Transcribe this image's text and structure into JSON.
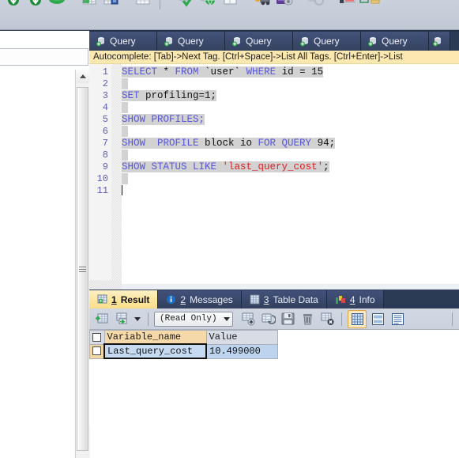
{
  "app": {
    "name": "sql-editor-window"
  },
  "toolbar": {
    "buttons": [
      {
        "name": "navicat-back-icon",
        "label": ""
      },
      {
        "name": "navicat-forward-icon",
        "label": ""
      },
      {
        "name": "navicat-green-icon",
        "label": ""
      },
      {
        "name": "new-table-icon",
        "label": ""
      },
      {
        "name": "table-design-icon",
        "label": ""
      },
      {
        "name": "table-grid-icon",
        "label": ""
      },
      {
        "name": "check-icon",
        "label": ""
      },
      {
        "name": "globe-icon",
        "label": ""
      },
      {
        "name": "panel-icon",
        "label": ""
      },
      {
        "name": "transfer-icon",
        "label": ""
      },
      {
        "name": "backup-icon",
        "label": ""
      },
      {
        "name": "circle-icon",
        "label": ""
      },
      {
        "name": "report-icon",
        "label": ""
      },
      {
        "name": "schedule-icon",
        "label": ""
      }
    ]
  },
  "left_pane": {
    "search_value": "",
    "search_placeholder": "",
    "scrollbar": {
      "position": "top"
    }
  },
  "query_tabs": [
    {
      "label": "Query",
      "icon": "query-icon",
      "active": false
    },
    {
      "label": "Query",
      "icon": "query-icon",
      "active": false
    },
    {
      "label": "Query",
      "icon": "query-icon",
      "active": false
    },
    {
      "label": "Query",
      "icon": "query-icon",
      "active": false
    },
    {
      "label": "Query",
      "icon": "query-icon",
      "active": false
    },
    {
      "label": "",
      "icon": "query-icon",
      "active": false
    }
  ],
  "autocomplete_hint": "Autocomplete: [Tab]->Next Tag. [Ctrl+Space]->List All Tags. [Ctrl+Enter]->List",
  "editor": {
    "line_numbers": [
      "1",
      "2",
      "3",
      "4",
      "5",
      "6",
      "7",
      "8",
      "9",
      "10",
      "11"
    ],
    "lines": [
      {
        "n": 1,
        "tokens": [
          {
            "t": "SELECT",
            "c": "kw"
          },
          {
            "t": " * ",
            "c": "pl"
          },
          {
            "t": "FROM",
            "c": "kw"
          },
          {
            "t": " `user` ",
            "c": "pl"
          },
          {
            "t": "WHERE",
            "c": "kw"
          },
          {
            "t": " id = 15",
            "c": "pl"
          }
        ]
      },
      {
        "n": 2,
        "tokens": []
      },
      {
        "n": 3,
        "tokens": [
          {
            "t": "SET",
            "c": "kw"
          },
          {
            "t": " profiling=1;",
            "c": "pl"
          }
        ]
      },
      {
        "n": 4,
        "tokens": []
      },
      {
        "n": 5,
        "tokens": [
          {
            "t": "SHOW PROFILES;",
            "c": "kw"
          }
        ]
      },
      {
        "n": 6,
        "tokens": []
      },
      {
        "n": 7,
        "tokens": [
          {
            "t": "SHOW  PROFILE",
            "c": "kw"
          },
          {
            "t": " block io ",
            "c": "pl"
          },
          {
            "t": "FOR QUERY",
            "c": "kw"
          },
          {
            "t": " 94;",
            "c": "pl"
          }
        ]
      },
      {
        "n": 8,
        "tokens": []
      },
      {
        "n": 9,
        "tokens": [
          {
            "t": "SHOW STATUS LIKE",
            "c": "kw"
          },
          {
            "t": " ",
            "c": "pl"
          },
          {
            "t": "'last_query_cost'",
            "c": "str"
          },
          {
            "t": ";",
            "c": "pl"
          }
        ]
      },
      {
        "n": 10,
        "tokens": []
      },
      {
        "n": 11,
        "tokens": []
      }
    ]
  },
  "result_tabs": [
    {
      "num": "1",
      "label": "Result",
      "icon": "result-grid-icon",
      "active": true
    },
    {
      "num": "2",
      "label": "Messages",
      "icon": "info-bubble-icon",
      "active": false
    },
    {
      "num": "3",
      "label": "Table Data",
      "icon": "table-data-icon",
      "active": false
    },
    {
      "num": "4",
      "label": "Info",
      "icon": "info-chart-icon",
      "active": false
    }
  ],
  "result_toolbar": {
    "mode_label": "(Read Only)",
    "buttons": [
      {
        "name": "begin-transaction-icon",
        "selected": false
      },
      {
        "name": "commit-icon",
        "selected": false
      },
      {
        "name": "add-record-icon",
        "selected": false
      },
      {
        "name": "duplicate-record-icon",
        "selected": false
      },
      {
        "name": "save-record-icon",
        "selected": false
      },
      {
        "name": "delete-record-icon",
        "selected": false
      },
      {
        "name": "cancel-record-icon",
        "selected": false
      },
      {
        "name": "grid-view-icon",
        "selected": true
      },
      {
        "name": "form-view-icon",
        "selected": false
      },
      {
        "name": "text-view-icon",
        "selected": false
      }
    ]
  },
  "result_grid": {
    "columns": [
      "Variable_name",
      "Value"
    ],
    "selected_column": "Variable_name",
    "rows": [
      {
        "checked": false,
        "cells": [
          "Last_query_cost",
          "10.499000"
        ]
      }
    ],
    "focused_cell": "Last_query_cost"
  },
  "colors": {
    "tab_bar": "#2b3a55",
    "hint_bar": "#fde9b0",
    "keyword": "#5555dd",
    "string": "#e02020",
    "selection": "#d2d2d2",
    "row_highlight": "#bdd4ef",
    "col_header_selected": "#f6d9a8"
  }
}
